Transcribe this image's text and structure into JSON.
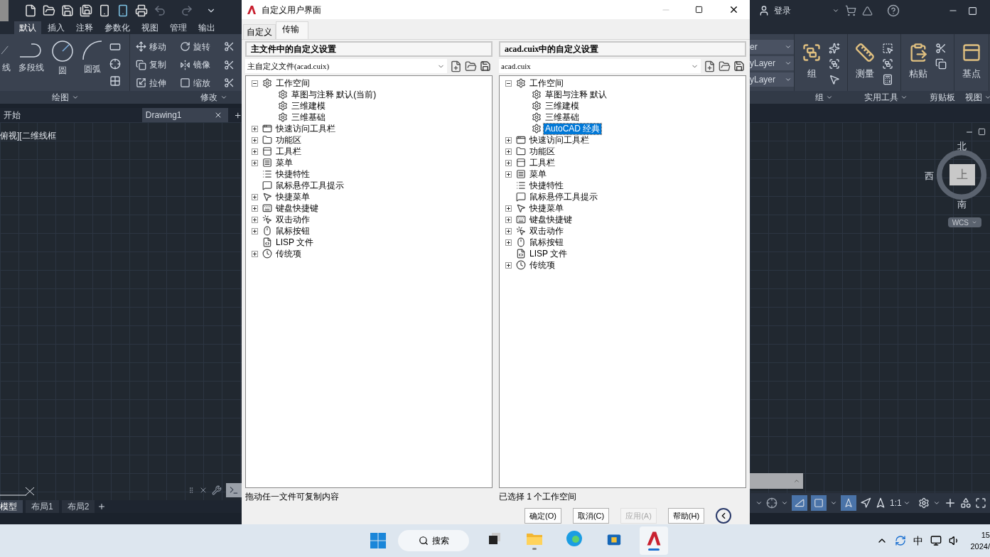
{
  "ribbon_tabs": [
    {
      "label": "默认",
      "selected": true
    },
    {
      "label": "插入",
      "selected": false
    },
    {
      "label": "注释",
      "selected": false
    },
    {
      "label": "参数化",
      "selected": false
    },
    {
      "label": "视图",
      "selected": false
    },
    {
      "label": "管理",
      "selected": false
    },
    {
      "label": "输出",
      "selected": false
    }
  ],
  "draw_panel": {
    "title": "绘图",
    "tools": [
      {
        "label": "线",
        "kind": "line"
      },
      {
        "label": "多段线",
        "kind": "polyline"
      },
      {
        "label": "圆",
        "kind": "circle"
      },
      {
        "label": "圆弧",
        "kind": "arc"
      }
    ]
  },
  "modify_panel": {
    "title": "修改",
    "tools": [
      {
        "label": "移动",
        "kind": "move"
      },
      {
        "label": "旋转",
        "kind": "rotate"
      },
      {
        "label": "复制",
        "kind": "copy"
      },
      {
        "label": "镜像",
        "kind": "mirror"
      },
      {
        "label": "拉伸",
        "kind": "stretch"
      },
      {
        "label": "缩放",
        "kind": "scale"
      }
    ]
  },
  "file_tabs": [
    {
      "label": "开始",
      "selected": false
    },
    {
      "label": "Drawing1",
      "selected": true
    }
  ],
  "viewport_label": "俯视][二维线框",
  "layout_tabs": [
    {
      "label": "模型",
      "selected": true
    },
    {
      "label": "布局1",
      "selected": false
    },
    {
      "label": "布局2",
      "selected": false
    }
  ],
  "user": {
    "sign_in": "登录"
  },
  "layer_fields": [
    "er",
    "yLayer",
    "yLayer"
  ],
  "right_panels": [
    {
      "title": "组",
      "tool": "组",
      "kind": "group"
    },
    {
      "title": "实用工具",
      "tool": "测量",
      "kind": "measure"
    },
    {
      "title": "剪贴板",
      "tool": "粘贴",
      "kind": "paste"
    },
    {
      "title": "视图",
      "tool": "基点",
      "kind": "basepoint"
    }
  ],
  "viewcube": {
    "north": "北",
    "west": "西",
    "face": "上",
    "south": "南",
    "ucs": "WCS"
  },
  "status_bar": {
    "scale": "1:1"
  },
  "dialog": {
    "title": "自定义用户界面",
    "tabs": [
      {
        "label": "自定义",
        "selected": false
      },
      {
        "label": "传输",
        "selected": true
      }
    ],
    "panes": [
      {
        "header": "主文件中的自定义设置",
        "file": "主自定义文件(acad.cuix)",
        "status": "拖动任一文件可复制内容",
        "tree": [
          {
            "label": "工作空间",
            "kind": "workspace",
            "selected": false,
            "expanded": true,
            "children": [
              {
                "label": "草图与注释 默认(当前)",
                "kind": "workspace",
                "selected": false
              },
              {
                "label": "三维建模",
                "kind": "workspace",
                "selected": false
              },
              {
                "label": "三维基础",
                "kind": "workspace",
                "selected": false
              }
            ]
          },
          {
            "label": "快速访问工具栏",
            "kind": "quickaccess",
            "selected": false,
            "expanded": false
          },
          {
            "label": "功能区",
            "kind": "ribbon",
            "selected": false,
            "expanded": false
          },
          {
            "label": "工具栏",
            "kind": "toolbar",
            "selected": false,
            "expanded": false
          },
          {
            "label": "菜单",
            "kind": "menu",
            "selected": false,
            "expanded": false
          },
          {
            "label": "快捷特性",
            "kind": "properties",
            "selected": false
          },
          {
            "label": "鼠标悬停工具提示",
            "kind": "tooltip",
            "selected": false
          },
          {
            "label": "快捷菜单",
            "kind": "shortcutmenu",
            "selected": false,
            "expanded": false
          },
          {
            "label": "键盘快捷键",
            "kind": "keyboard",
            "selected": false,
            "expanded": false
          },
          {
            "label": "双击动作",
            "kind": "doubleclick",
            "selected": false,
            "expanded": false
          },
          {
            "label": "鼠标按钮",
            "kind": "mouse",
            "selected": false,
            "expanded": false
          },
          {
            "label": "LISP 文件",
            "kind": "lisp",
            "selected": false
          },
          {
            "label": "传统项",
            "kind": "legacy",
            "selected": false,
            "expanded": false
          }
        ]
      },
      {
        "header": "acad.cuix中的自定义设置",
        "file": "acad.cuix",
        "status": "已选择 1 个工作空间",
        "tree": [
          {
            "label": "工作空间",
            "kind": "workspace",
            "selected": false,
            "expanded": true,
            "children": [
              {
                "label": "草图与注释 默认",
                "kind": "workspace",
                "selected": false
              },
              {
                "label": "三维建模",
                "kind": "workspace",
                "selected": false
              },
              {
                "label": "三维基础",
                "kind": "workspace",
                "selected": false
              },
              {
                "label": "AutoCAD 经典",
                "kind": "workspace",
                "selected": true
              }
            ]
          },
          {
            "label": "快速访问工具栏",
            "kind": "quickaccess",
            "selected": false,
            "expanded": false
          },
          {
            "label": "功能区",
            "kind": "ribbon",
            "selected": false,
            "expanded": false
          },
          {
            "label": "工具栏",
            "kind": "toolbar",
            "selected": false,
            "expanded": false
          },
          {
            "label": "菜单",
            "kind": "menu",
            "selected": false,
            "expanded": false
          },
          {
            "label": "快捷特性",
            "kind": "properties",
            "selected": false
          },
          {
            "label": "鼠标悬停工具提示",
            "kind": "tooltip",
            "selected": false
          },
          {
            "label": "快捷菜单",
            "kind": "shortcutmenu",
            "selected": false,
            "expanded": false
          },
          {
            "label": "键盘快捷键",
            "kind": "keyboard",
            "selected": false,
            "expanded": false
          },
          {
            "label": "双击动作",
            "kind": "doubleclick",
            "selected": false,
            "expanded": false
          },
          {
            "label": "鼠标按钮",
            "kind": "mouse",
            "selected": false,
            "expanded": false
          },
          {
            "label": "LISP 文件",
            "kind": "lisp",
            "selected": false
          },
          {
            "label": "传统项",
            "kind": "legacy",
            "selected": false,
            "expanded": false
          }
        ]
      }
    ],
    "buttons": [
      {
        "label": "确定(O)",
        "disabled": false
      },
      {
        "label": "取消(C)",
        "disabled": false
      },
      {
        "label": "应用(A)",
        "disabled": true
      },
      {
        "label": "帮助(H)",
        "disabled": false
      }
    ]
  },
  "taskbar": {
    "search": "搜索",
    "apps": [
      {
        "kind": "taskview",
        "selected": false,
        "running": false
      },
      {
        "kind": "explorer",
        "selected": false,
        "running": true
      },
      {
        "kind": "edge",
        "selected": false,
        "running": false
      },
      {
        "kind": "store",
        "selected": false,
        "running": false
      },
      {
        "kind": "autocad",
        "selected": true,
        "running": true
      }
    ],
    "ime": "中",
    "time": "15",
    "date": "2024/"
  }
}
